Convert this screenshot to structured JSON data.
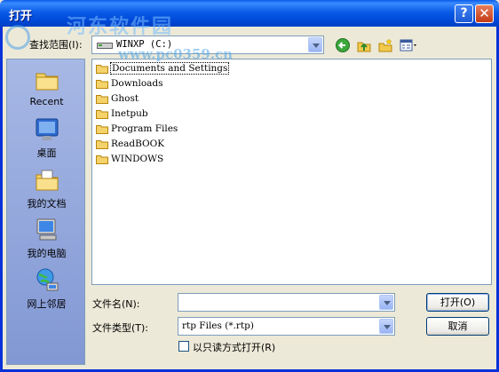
{
  "title": "打开",
  "watermark": {
    "text": "河东软件园",
    "url": "www.pc0359.cn"
  },
  "titlebar": {
    "help": "?",
    "close": "✕"
  },
  "lookin": {
    "label": "查找范围(I):",
    "value": "WINXP (C:)"
  },
  "places": [
    "Recent",
    "桌面",
    "我的文档",
    "我的电脑",
    "网上邻居"
  ],
  "files": [
    "Documents and Settings",
    "Downloads",
    "Ghost",
    "Inetpub",
    "Program Files",
    "ReadBOOK",
    "WINDOWS"
  ],
  "filename": {
    "label": "文件名(N):",
    "value": ""
  },
  "filetype": {
    "label": "文件类型(T):",
    "value": "rtp Files (*.rtp)"
  },
  "readonly": {
    "label": "以只读方式打开(R)",
    "checked": false
  },
  "buttons": {
    "open": "打开(O)",
    "cancel": "取消"
  }
}
